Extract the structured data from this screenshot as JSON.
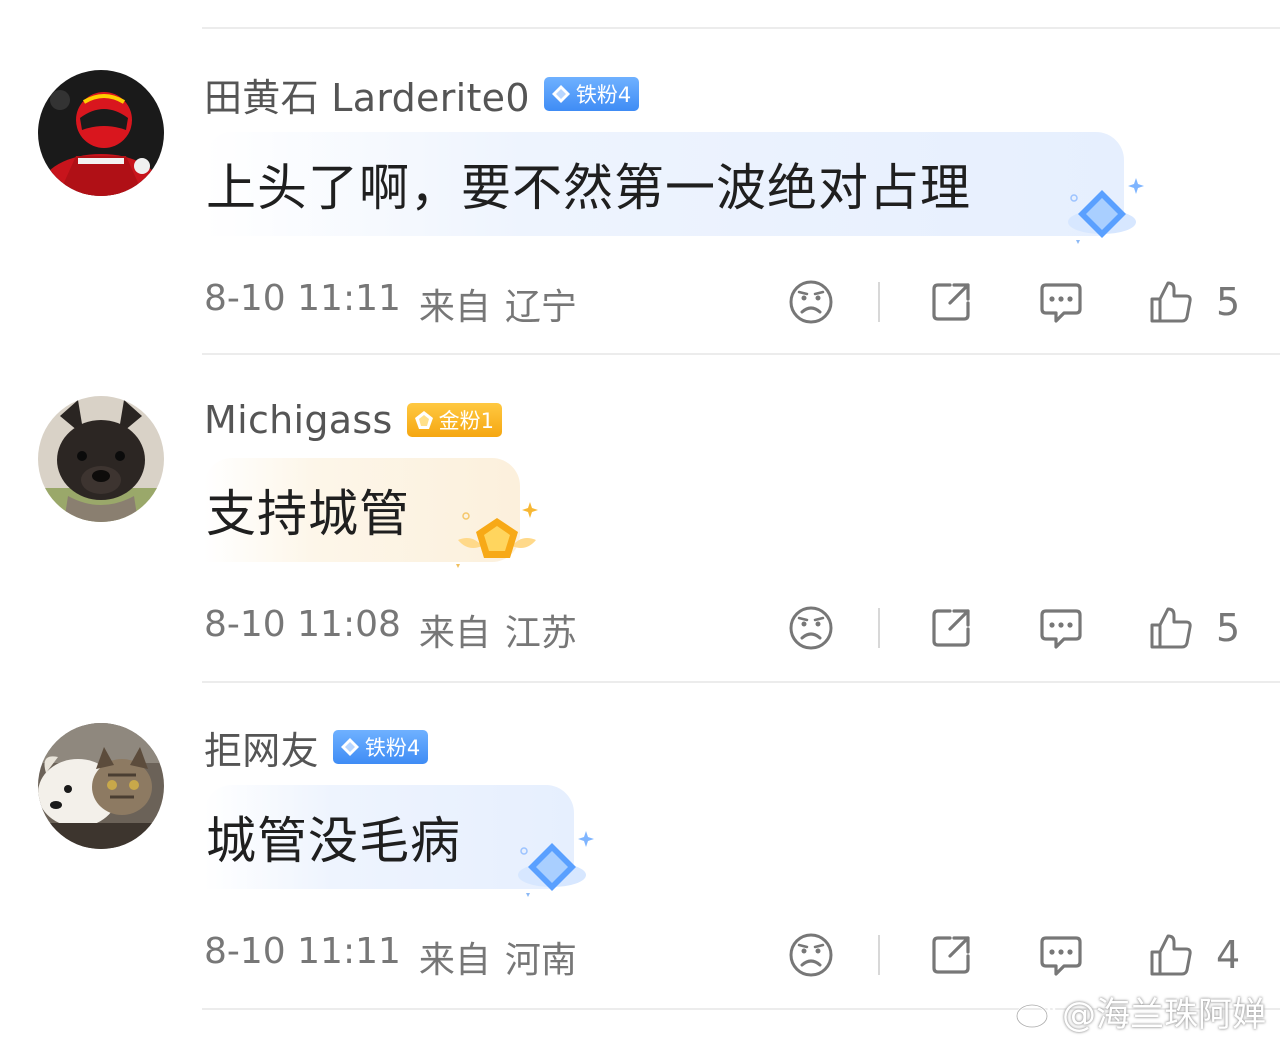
{
  "comments": [
    {
      "username": "田黄石 Larderite0",
      "badge": {
        "label": "铁粉4",
        "tone": "blue"
      },
      "text": "上头了啊，要不然第一波绝对占理",
      "time": "8-10 11:11",
      "from_label": "来自",
      "location": "辽宁",
      "likes": "5",
      "avatar": "red-racing-helmet-driver"
    },
    {
      "username": "Michigass",
      "badge": {
        "label": "金粉1",
        "tone": "gold"
      },
      "text": "支持城管",
      "time": "8-10 11:08",
      "from_label": "来自",
      "location": "江苏",
      "likes": "5",
      "avatar": "french-bulldog"
    },
    {
      "username": "拒网友",
      "badge": {
        "label": "铁粉4",
        "tone": "blue"
      },
      "text": "城管没毛病",
      "time": "8-10 11:11",
      "from_label": "来自",
      "location": "河南",
      "likes": "4",
      "avatar": "white-dog-and-tabby-cat"
    }
  ],
  "watermark": "@海兰珠阿婵",
  "colors": {
    "badge_blue": "#4a93f7",
    "badge_gold": "#f7b21f",
    "meta_gray": "#777777",
    "divider": "#ececec"
  }
}
